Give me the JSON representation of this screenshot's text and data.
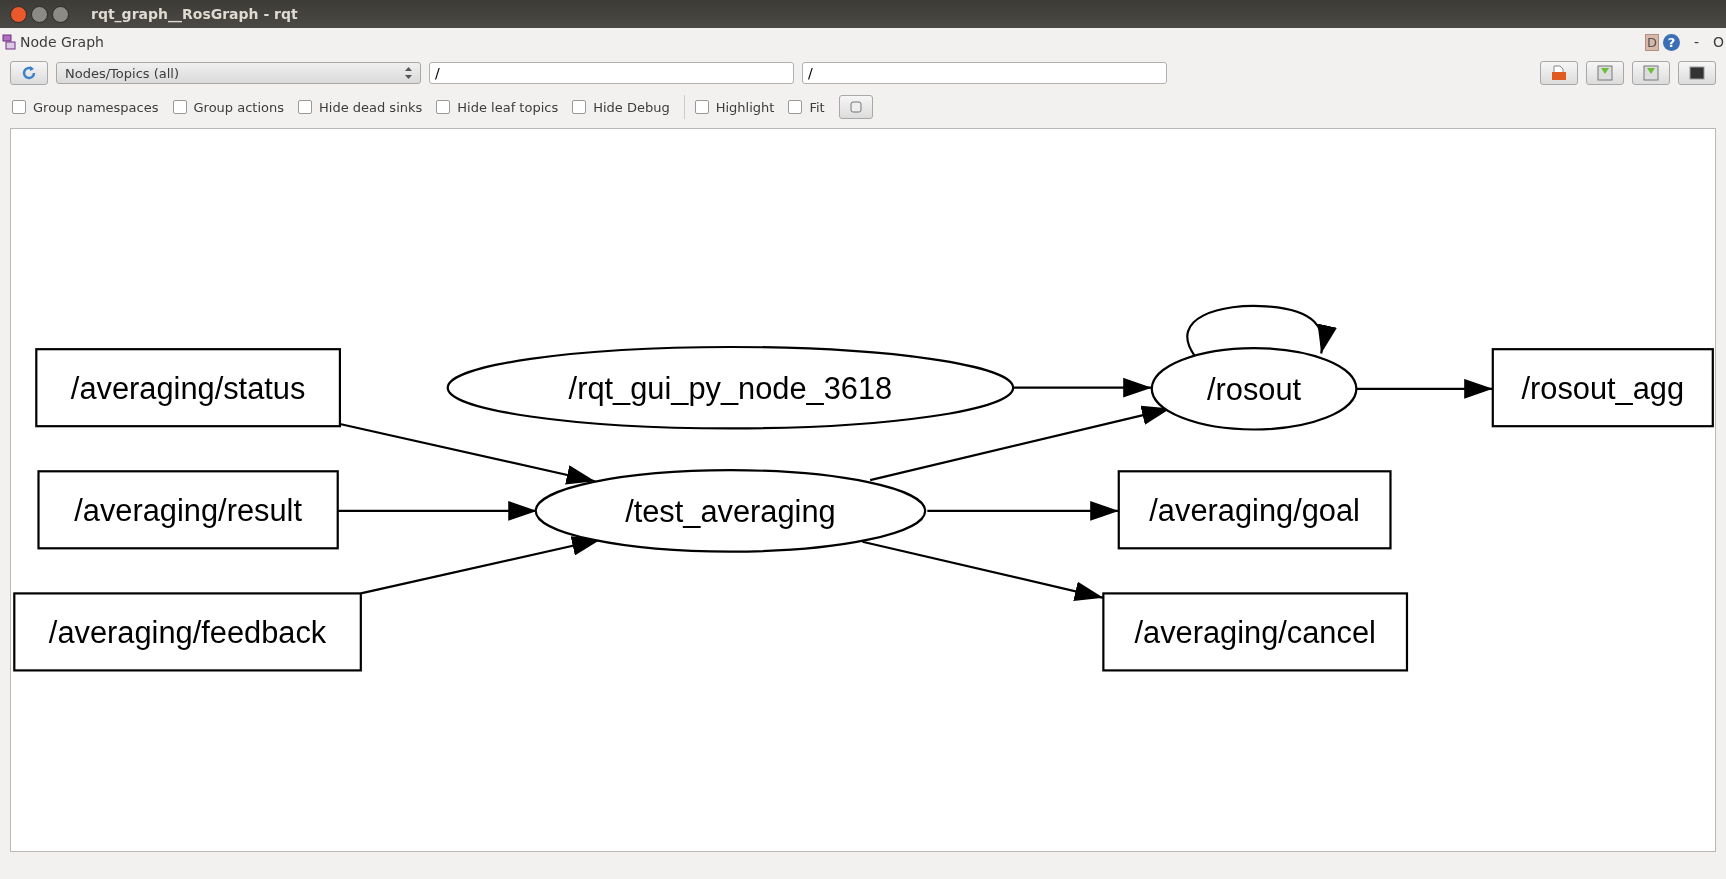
{
  "window": {
    "title": "rqt_graph__RosGraph - rqt"
  },
  "plugin": {
    "title": "Node Graph",
    "debug_label": "D",
    "help_label": "?",
    "minimize_label": "-",
    "close_label": "O"
  },
  "toolbar": {
    "graph_type": "Nodes/Topics (all)",
    "node_filter": "/",
    "topic_filter": "/"
  },
  "options": [
    {
      "label": "Group namespaces",
      "checked": false
    },
    {
      "label": "Group actions",
      "checked": false
    },
    {
      "label": "Hide dead sinks",
      "checked": false
    },
    {
      "label": "Hide leaf topics",
      "checked": false
    },
    {
      "label": "Hide Debug",
      "checked": false
    },
    {
      "label": "Highlight",
      "checked": false
    },
    {
      "label": "Fit",
      "checked": false
    }
  ],
  "graph": {
    "nodes": [
      {
        "label": "/averaging/status",
        "kind": "topic"
      },
      {
        "label": "/rqt_gui_py_node_3618",
        "kind": "node"
      },
      {
        "label": "/rosout",
        "kind": "node"
      },
      {
        "label": "/rosout_agg",
        "kind": "topic"
      },
      {
        "label": "/averaging/result",
        "kind": "topic"
      },
      {
        "label": "/test_averaging",
        "kind": "node"
      },
      {
        "label": "/averaging/goal",
        "kind": "topic"
      },
      {
        "label": "/averaging/feedback",
        "kind": "topic"
      },
      {
        "label": "/averaging/cancel",
        "kind": "topic"
      }
    ]
  }
}
